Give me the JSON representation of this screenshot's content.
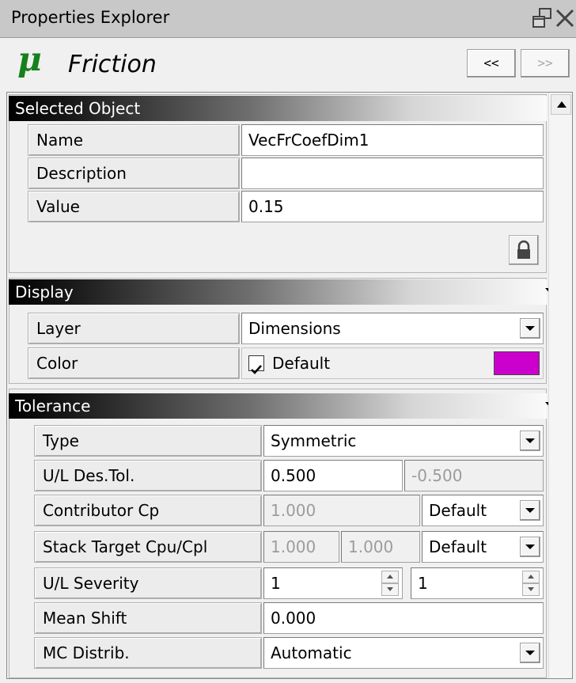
{
  "window": {
    "title": "Properties Explorer"
  },
  "header": {
    "object_icon_glyph": "μ",
    "object_icon_name": "mu-icon",
    "object_name": "Friction",
    "prev_label": "<<",
    "next_label": ">>"
  },
  "selected_object": {
    "heading": "Selected Object",
    "name_label": "Name",
    "name_value": "VecFrCoefDim1",
    "description_label": "Description",
    "description_value": "",
    "value_label": "Value",
    "value_value": "0.15",
    "lock_icon": "lock-icon"
  },
  "display": {
    "heading": "Display",
    "layer_label": "Layer",
    "layer_value": "Dimensions",
    "color_label": "Color",
    "color_checked": true,
    "color_default_label": "Default",
    "color_swatch": "#cc00cc"
  },
  "tolerance": {
    "heading": "Tolerance",
    "type_label": "Type",
    "type_value": "Symmetric",
    "ul_des_tol_label": "U/L Des.Tol.",
    "upper_tol": "0.500",
    "lower_tol": "-0.500",
    "contributor_cp_label": "Contributor Cp",
    "contributor_cp_value": "1.000",
    "contributor_cp_mode": "Default",
    "stack_target_label": "Stack Target Cpu/Cpl",
    "stack_target_cpu": "1.000",
    "stack_target_cpl": "1.000",
    "stack_target_mode": "Default",
    "ul_severity_label": "U/L Severity",
    "upper_severity": "1",
    "lower_severity": "1",
    "mean_shift_label": "Mean Shift",
    "mean_shift_value": "0.000",
    "mc_distrib_label": "MC Distrib.",
    "mc_distrib_value": "Automatic"
  },
  "colors": {
    "mu_green": "#16801c",
    "header_gradient_start": "#000000",
    "header_gradient_end": "#fafafa"
  }
}
